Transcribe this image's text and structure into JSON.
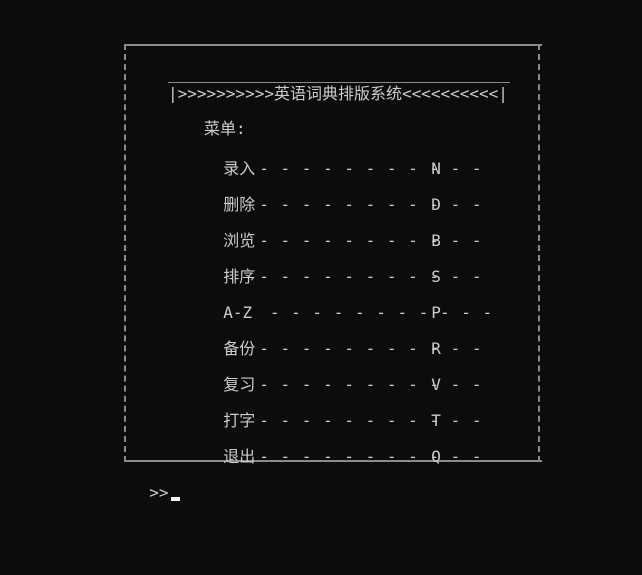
{
  "title": "|>>>>>>>>>>英语词典排版系统<<<<<<<<<<|",
  "menu_header": "菜单:",
  "menu": [
    {
      "label": "录入",
      "dashes": "- - - - - - - - - - -",
      "key": "N"
    },
    {
      "label": "删除",
      "dashes": "- - - - - - - - - - -",
      "key": "D"
    },
    {
      "label": "浏览",
      "dashes": "- - - - - - - - - - -",
      "key": "B"
    },
    {
      "label": "排序",
      "dashes": "- - - - - - - - - - -",
      "key": "S"
    },
    {
      "label": "A-Z",
      "dashes": " - - - - - - - - - - -",
      "key": "P"
    },
    {
      "label": "备份",
      "dashes": "- - - - - - - - - - -",
      "key": "R"
    },
    {
      "label": "复习",
      "dashes": "- - - - - - - - - - -",
      "key": "V"
    },
    {
      "label": "打字",
      "dashes": "- - - - - - - - - - -",
      "key": "T"
    },
    {
      "label": "退出",
      "dashes": "- - - - - - - - - - -",
      "key": "Q"
    }
  ],
  "prompt": ">>",
  "colors": {
    "background": "#0c0c0c",
    "text": "#cccccc",
    "border": "#8a8a8a",
    "cursor": "#f2f2f2"
  }
}
